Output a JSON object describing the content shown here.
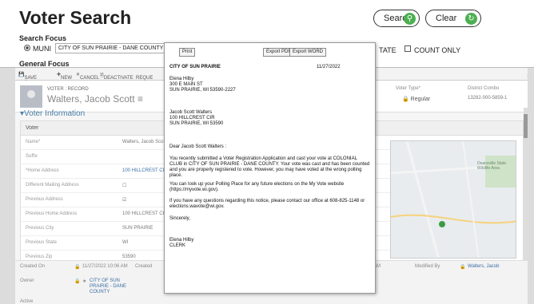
{
  "search": {
    "title": "Voter Search",
    "search_label": "Search",
    "clear_label": "Clear",
    "focus_label": "Search Focus",
    "muni_label": "MUNI",
    "muni_value": "CITY OF SUN PRAIRIE - DANE COUNTY",
    "state_label": "TATE",
    "count_only_label": "COUNT ONLY",
    "general_focus_label": "General Focus"
  },
  "toolbar": {
    "save_close": "SAVE & CLOSE",
    "new": "NEW",
    "cancel": "CANCEL",
    "deactivate": "DEACTIVATE",
    "request": "REQUE"
  },
  "record": {
    "type": "VOTER : RECORD",
    "name": "Walters, Jacob Scott",
    "voter_type_label": "Voter Type*",
    "voter_type_value": "Regular",
    "district_label": "District Combo",
    "district_value": "13282-000-5859-1"
  },
  "section": {
    "title": "Voter Information",
    "panel_header": "Voter",
    "fields": [
      {
        "label": "Name*",
        "value": "Walters, Jacob Scot"
      },
      {
        "label": "Suffix",
        "value": ""
      },
      {
        "label": "*Home Address",
        "value": "100 HILLCREST CIR"
      },
      {
        "label": "Different Mailing Address",
        "value": "☐"
      },
      {
        "label": "Previous Address",
        "value": "☑"
      },
      {
        "label": "Previous Home Address",
        "value": "100 HILLCREST CIR"
      },
      {
        "label": "Previous City",
        "value": "SUN PRAIRIE"
      },
      {
        "label": "Previous State",
        "value": "WI"
      },
      {
        "label": "Previous Zip",
        "value": "53590"
      }
    ]
  },
  "map": {
    "label": "Deansville State Wildlife Area"
  },
  "footer": {
    "created_on_label": "Created On",
    "created_on_value": "11/27/2022 10:06 AM",
    "created_by_label": "Created",
    "owner_label": "Owner",
    "owner_value": "CITY OF SUN PRAIRIE - DANE COUNTY",
    "modified_time": "AM",
    "modified_by_label": "Modified By",
    "modified_by_value": "Walters, Jacob",
    "status_label": "Active"
  },
  "letter": {
    "print": "Print",
    "export_pdf": "Export PDF",
    "export_word": "Export WORD",
    "from_city": "CITY OF SUN PRAIRIE",
    "date": "11/27/2022",
    "from_name": "Elena Hilby",
    "from_addr1": "300 E MAIN ST",
    "from_addr2": "SUN PRAIRIE, WI 53590-2227",
    "to_name": "Jacob Scott Walters",
    "to_addr1": "100 HILLCREST CIR",
    "to_addr2": "SUN PRAIRIE, WI  53590",
    "salutation": "Dear Jacob Scott Walters :",
    "para1": "You recently submitted a Voter Registration Application and cast your vote at COLONIAL CLUB in CITY OF SUN PRAIRIE - DANE COUNTY.  Your vote was cast and has been counted and you are properly registered to vote.  However, you may have voted at the wrong polling place.",
    "para2": "You can look up your Polling Place for any future elections on the My Vote website (https://myvote.wi.gov).",
    "para3": "If you have any questions regarding this notice, please contact our office at 608-825-1148 or elections.wavote@wi.gov.",
    "closing": "Sincerely,",
    "signer": "Elena Hilby",
    "signer_title": "CLERK"
  }
}
